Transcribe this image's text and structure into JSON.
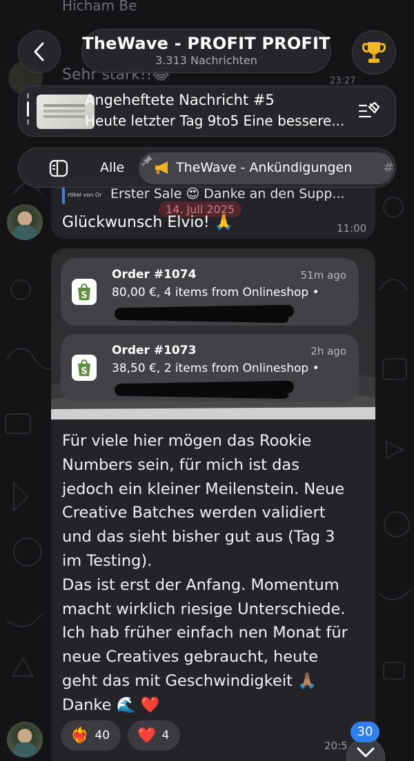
{
  "background_color": "#141417",
  "ghost": {
    "sender": "Hicham Be",
    "text": "Sehr stark!!😂",
    "time": "23:27"
  },
  "header": {
    "title": "TheWave - PROFIT PROFIT",
    "subtitle": "3.313 Nachrichten"
  },
  "pinned": {
    "title": "Angeheftete Nachricht #5",
    "text": "Heute letzter Tag 9to5 Eine bessere..."
  },
  "tabs": {
    "all": "Alle",
    "active": "TheWave - Ankündigungen",
    "more": "#"
  },
  "reply_message": {
    "quote_mini": "rtikel von Or",
    "quote_text": "Erster Sale 😍 Danke an den Supp...",
    "date_chip": "14. Juli 2025",
    "text": "Glückwunsch Elvio! 🙏",
    "time": "11:00"
  },
  "big_message": {
    "orders": [
      {
        "title": "Order #1074",
        "time": "51m ago",
        "text": "80,00 €, 4 items from Onlineshop •"
      },
      {
        "title": "Order #1073",
        "time": "2h ago",
        "text": "38,50 €, 2 items from Onlineshop •"
      }
    ],
    "text": "Für viele hier mögen das Rookie\nNumbers sein, für mich ist das\njedoch ein kleiner Meilenstein. Neue\nCreative Batches werden validiert\nund das sieht bisher gut aus (Tag 3\nim Testing).\nDas ist erst der Anfang. Momentum\nmacht wirklich riesige Unterschiede.\nIch hab früher einfach nen Monat für\nneue Creatives gebraucht, heute\ngeht das mit Geschwindigkeit 🙏🏽\nDanke 🌊 ❤️",
    "reactions": [
      {
        "icon": "❤️‍🔥",
        "count": "40"
      },
      {
        "icon": "❤️",
        "count": "4"
      }
    ],
    "time": "20:5"
  },
  "unread_count": "30"
}
